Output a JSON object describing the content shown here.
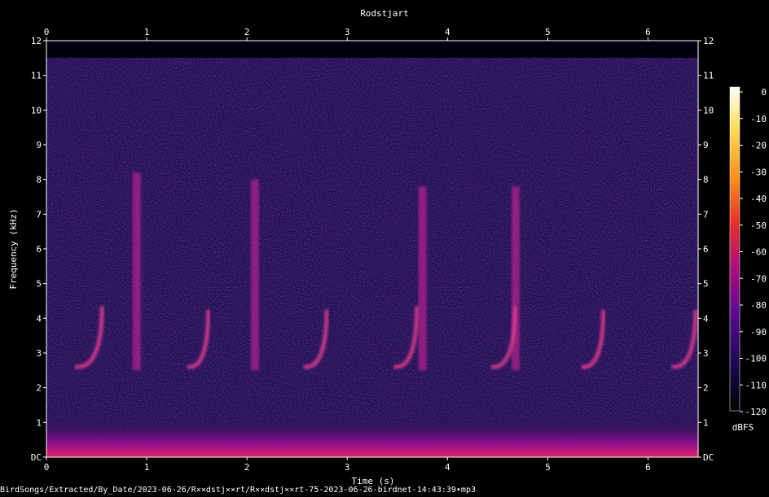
{
  "chart_data": {
    "type": "heatmap",
    "title": "Rodstjart",
    "xlabel": "Time (s)",
    "ylabel": "Frequency (kHz)",
    "xlim": [
      0,
      6.5
    ],
    "ylim": [
      0,
      12
    ],
    "x_ticks": [
      "0",
      "1",
      "2",
      "3",
      "4",
      "5",
      "6"
    ],
    "y_ticks": [
      "DC",
      "1",
      "2",
      "3",
      "4",
      "5",
      "6",
      "7",
      "8",
      "9",
      "10",
      "11",
      "12"
    ],
    "colorbar": {
      "unit": "dBFS",
      "ticks": [
        "0",
        "-10",
        "-20",
        "-30",
        "-40",
        "-50",
        "-60",
        "-70",
        "-80",
        "-90",
        "-100",
        "-110",
        "-120"
      ],
      "range": [
        -120,
        0
      ],
      "colors": [
        "#000000",
        "#1a0a4d",
        "#5a0a8f",
        "#b0107a",
        "#e8302a",
        "#f7901a",
        "#ffe060",
        "#ffffff"
      ]
    },
    "background": "#1a0a48",
    "signal_max_freq_khz": 11.5,
    "calls": [
      {
        "t0": 0.3,
        "t1": 0.58,
        "f0": 2.6,
        "f1": 4.3
      },
      {
        "t0": 1.42,
        "t1": 1.64,
        "f0": 2.6,
        "f1": 4.2
      },
      {
        "t0": 2.58,
        "t1": 2.82,
        "f0": 2.6,
        "f1": 4.2
      },
      {
        "t0": 3.48,
        "t1": 3.72,
        "f0": 2.6,
        "f1": 4.3
      },
      {
        "t0": 4.45,
        "t1": 4.7,
        "f0": 2.6,
        "f1": 4.3
      },
      {
        "t0": 5.35,
        "t1": 5.58,
        "f0": 2.6,
        "f1": 4.2
      },
      {
        "t0": 6.25,
        "t1": 6.5,
        "f0": 2.6,
        "f1": 4.2
      }
    ],
    "broadband_columns": [
      {
        "t": 0.9,
        "f0": 2.5,
        "f1": 8.2
      },
      {
        "t": 2.08,
        "f0": 2.5,
        "f1": 8.0
      },
      {
        "t": 3.75,
        "f0": 2.5,
        "f1": 7.8
      },
      {
        "t": 4.68,
        "f0": 2.5,
        "f1": 7.8
      }
    ]
  },
  "footer": "BirdSongs/Extracted/By_Date/2023-06-26/R××dstj××rt/R××dstj××rt-75-2023-06-26-birdnet-14:43:39•mp3"
}
